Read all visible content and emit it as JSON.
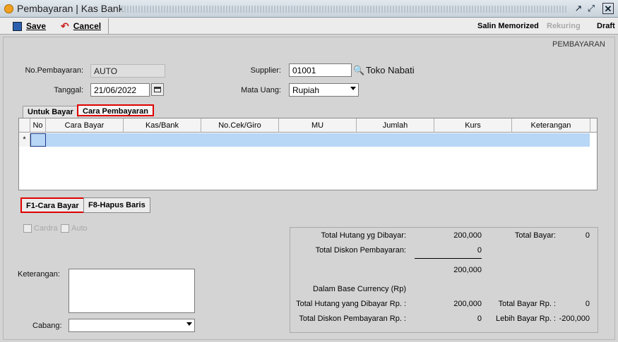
{
  "window": {
    "title": "Pembayaran | Kas Bank"
  },
  "toolbar": {
    "save_label": "Save",
    "cancel_label": "Cancel",
    "salin_label": "Salin Memorized",
    "rekuring_label": "Rekuring",
    "draft_label": "Draft"
  },
  "header": {
    "section_title": "PEMBAYARAN"
  },
  "form": {
    "no_pembayaran_label": "No.Pembayaran:",
    "no_pembayaran_value": "AUTO",
    "tanggal_label": "Tanggal:",
    "tanggal_value": "21/06/2022",
    "supplier_label": "Supplier:",
    "supplier_value": "01001",
    "supplier_name": "Toko Nabati",
    "mata_uang_label": "Mata Uang:",
    "mata_uang_value": "Rupiah"
  },
  "tabs": [
    {
      "label": "Untuk Bayar"
    },
    {
      "label": "Cara Pembayaran"
    }
  ],
  "grid": {
    "columns": [
      "No",
      "Cara Bayar",
      "Kas/Bank",
      "No.Cek/Giro",
      "MU",
      "Jumlah",
      "Kurs",
      "Keterangan"
    ],
    "row_marker": "*"
  },
  "grid_buttons": {
    "f1": "F1-Cara Bayar",
    "f8": "F8-Hapus Baris"
  },
  "options": {
    "cardra": "Cardra",
    "auto": "Auto"
  },
  "bottom": {
    "keterangan_label": "Keterangan:",
    "cabang_label": "Cabang:"
  },
  "summary": {
    "total_hutang_label": "Total Hutang yg Dibayar:",
    "total_hutang_value": "200,000",
    "total_bayar_label": "Total Bayar:",
    "total_bayar_value": "0",
    "total_diskon_label": "Total Diskon Pembayaran:",
    "total_diskon_value": "0",
    "subtotal_value": "200,000",
    "base_currency_label": "Dalam Base Currency (Rp)",
    "total_hutang_rp_label": "Total Hutang yang Dibayar Rp. :",
    "total_hutang_rp_value": "200,000",
    "total_bayar_rp_label": "Total Bayar Rp. :",
    "total_bayar_rp_value": "0",
    "total_diskon_rp_label": "Total Diskon Pembayaran Rp. :",
    "total_diskon_rp_value": "0",
    "lebih_bayar_label": "Lebih Bayar Rp. :",
    "lebih_bayar_value": "-200,000"
  }
}
